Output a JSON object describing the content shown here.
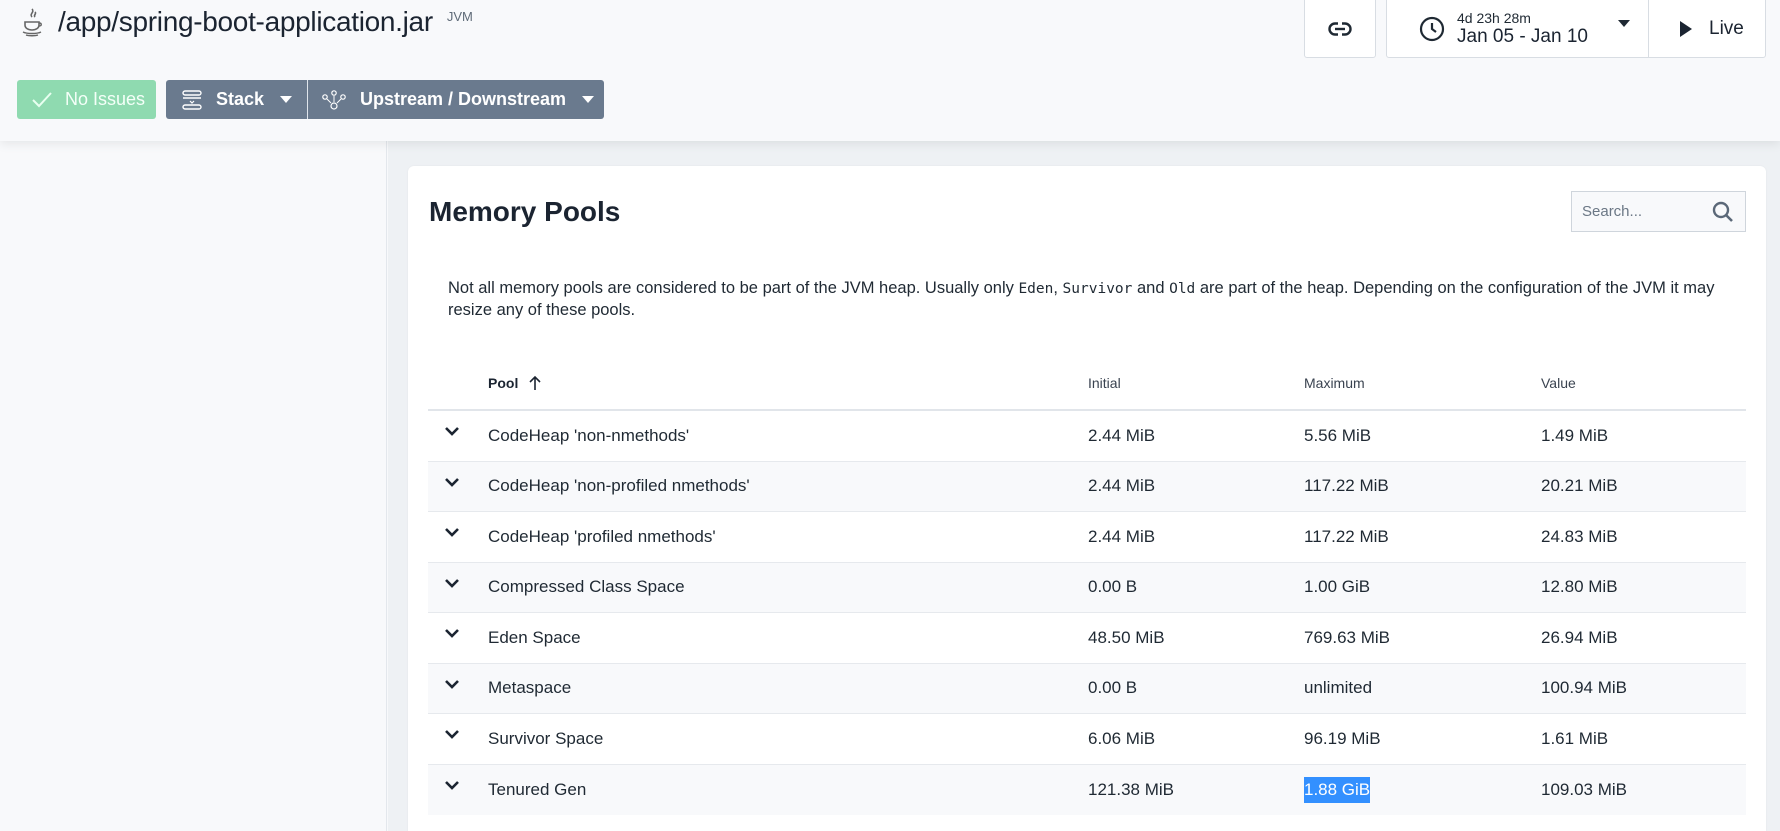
{
  "header": {
    "app_icon": "java-icon",
    "title": "/app/spring-boot-application.jar",
    "badge": "JVM",
    "buttons": {
      "status": {
        "label": "No Issues",
        "icon": "check-icon"
      },
      "stack": {
        "label": "Stack",
        "icon": "stack-icon"
      },
      "topology": {
        "label": "Upstream / Downstream",
        "icon": "topology-icon"
      }
    },
    "link_button_icon": "link-icon",
    "time_range": {
      "duration": "4d 23h 28m",
      "dates": "Jan 05 - Jan 10",
      "icon": "clock-icon"
    },
    "live_button": {
      "label": "Live",
      "icon": "play-icon"
    }
  },
  "card": {
    "title": "Memory Pools",
    "search": {
      "placeholder": "Search...",
      "value": ""
    },
    "description": {
      "part1": "Not all memory pools are considered to be part of the JVM heap. Usually only ",
      "code1": "Eden",
      "part2": ", ",
      "code2": "Survivor",
      "part3": " and ",
      "code3": "Old",
      "part4": " are part of the heap. Depending on the configuration of the JVM it may resize any of these pools."
    },
    "table": {
      "columns": {
        "pool": "Pool",
        "initial": "Initial",
        "maximum": "Maximum",
        "value": "Value"
      },
      "sort": {
        "column": "Pool",
        "direction": "ascending"
      },
      "rows": [
        {
          "pool": "CodeHeap 'non-nmethods'",
          "initial": "2.44 MiB",
          "maximum": "5.56 MiB",
          "value": "1.49 MiB"
        },
        {
          "pool": "CodeHeap 'non-profiled nmethods'",
          "initial": "2.44 MiB",
          "maximum": "117.22 MiB",
          "value": "20.21 MiB"
        },
        {
          "pool": "CodeHeap 'profiled nmethods'",
          "initial": "2.44 MiB",
          "maximum": "117.22 MiB",
          "value": "24.83 MiB"
        },
        {
          "pool": "Compressed Class Space",
          "initial": "0.00 B",
          "maximum": "1.00 GiB",
          "value": "12.80 MiB"
        },
        {
          "pool": "Eden Space",
          "initial": "48.50 MiB",
          "maximum": "769.63 MiB",
          "value": "26.94 MiB"
        },
        {
          "pool": "Metaspace",
          "initial": "0.00 B",
          "maximum": "unlimited",
          "value": "100.94 MiB"
        },
        {
          "pool": "Survivor Space",
          "initial": "6.06 MiB",
          "maximum": "96.19 MiB",
          "value": "1.61 MiB"
        },
        {
          "pool": "Tenured Gen",
          "initial": "121.38 MiB",
          "maximum": "1.88 GiB",
          "value": "109.03 MiB"
        }
      ],
      "selected_text": "1.88 GiB"
    }
  },
  "colors": {
    "status_ok": "#8fdab0",
    "button_slate": "#6a7a8e",
    "selection": "#3390ff"
  }
}
